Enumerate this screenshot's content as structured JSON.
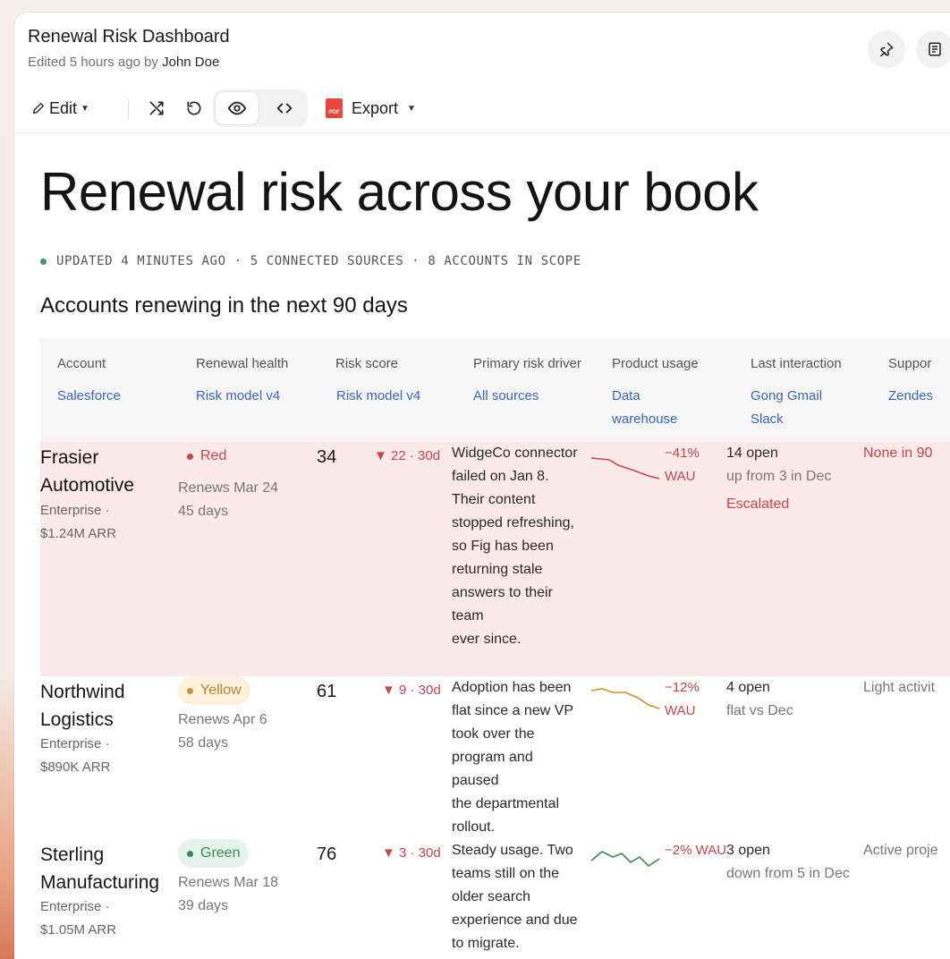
{
  "header": {
    "title": "Renewal Risk Dashboard",
    "edited_prefix": "Edited 5 hours ago by",
    "author": "John Doe"
  },
  "toolbar": {
    "edit_label": "Edit",
    "export_label": "Export",
    "pdf_badge": "PDF"
  },
  "page": {
    "heading": "Renewal risk across your book",
    "meta": "UPDATED 4 MINUTES AGO · 5 CONNECTED SOURCES · 8 ACCOUNTS IN SCOPE",
    "section_title": "Accounts renewing in the next 90 days"
  },
  "columns": [
    {
      "label": "Account",
      "sources": [
        "Salesforce"
      ]
    },
    {
      "label": "Renewal health",
      "sources": [
        "Risk model v4"
      ]
    },
    {
      "label": "Risk score",
      "sources": [
        "Risk model v4"
      ]
    },
    {
      "label": "Primary risk driver",
      "sources": [
        "All sources"
      ]
    },
    {
      "label": "Product usage",
      "sources": [
        "Data",
        "warehouse"
      ]
    },
    {
      "label": "Last interaction",
      "sources": [
        "Gong Gmail",
        "Slack"
      ]
    },
    {
      "label": "Suppor",
      "sources": [
        "Zendes"
      ]
    }
  ],
  "rows": [
    {
      "name_1": "Frasier",
      "name_2": "Automotive",
      "tier": "Enterprise ·",
      "arr": "$1.24M ARR",
      "health": "Red",
      "renews": "Renews Mar 24",
      "days": "45 days",
      "score": "34",
      "delta": "▼ 22 · 30d",
      "driver_lines": [
        "WidgeCo connector",
        "failed on Jan 8.",
        "Their content",
        "stopped refreshing,",
        "so Fig has been",
        "returning stale",
        "answers to their",
        "team",
        "ever since."
      ],
      "usage_1": "−41%",
      "usage_2": "WAU",
      "interaction_1": "14 open",
      "interaction_2": "up from 3 in Dec",
      "interaction_3": "Escalated",
      "support": "None in 90"
    },
    {
      "name_1": "Northwind",
      "name_2": "Logistics",
      "tier": "Enterprise ·",
      "arr": "$890K ARR",
      "health": "Yellow",
      "renews": "Renews Apr 6",
      "days": "58 days",
      "score": "61",
      "delta": "▼ 9 · 30d",
      "driver_lines": [
        "Adoption has been",
        "flat since a new VP",
        "took over the",
        "program and",
        "paused",
        "the departmental",
        "rollout."
      ],
      "usage_1": "−12%",
      "usage_2": "WAU",
      "interaction_1": "4 open",
      "interaction_2": "flat vs Dec",
      "support": "Light activit"
    },
    {
      "name_1": "Sterling",
      "name_2": "Manufacturing",
      "tier": "Enterprise ·",
      "arr": "$1.05M ARR",
      "health": "Green",
      "renews": "Renews Mar 18",
      "days": "39 days",
      "score": "76",
      "delta": "▼ 3 · 30d",
      "driver_lines": [
        "Steady usage. Two",
        "teams still on the",
        "older search",
        "experience and due",
        "to migrate."
      ],
      "usage_1": "−2% WAU",
      "interaction_1": "3 open",
      "interaction_2": "down from 5 in Dec",
      "support": "Active proje"
    }
  ],
  "colors": {
    "red": "#c8454a",
    "yellow": "#c9922c",
    "green": "#3a8a55",
    "link": "#3a67b8",
    "red_row": "#fce9ea"
  }
}
